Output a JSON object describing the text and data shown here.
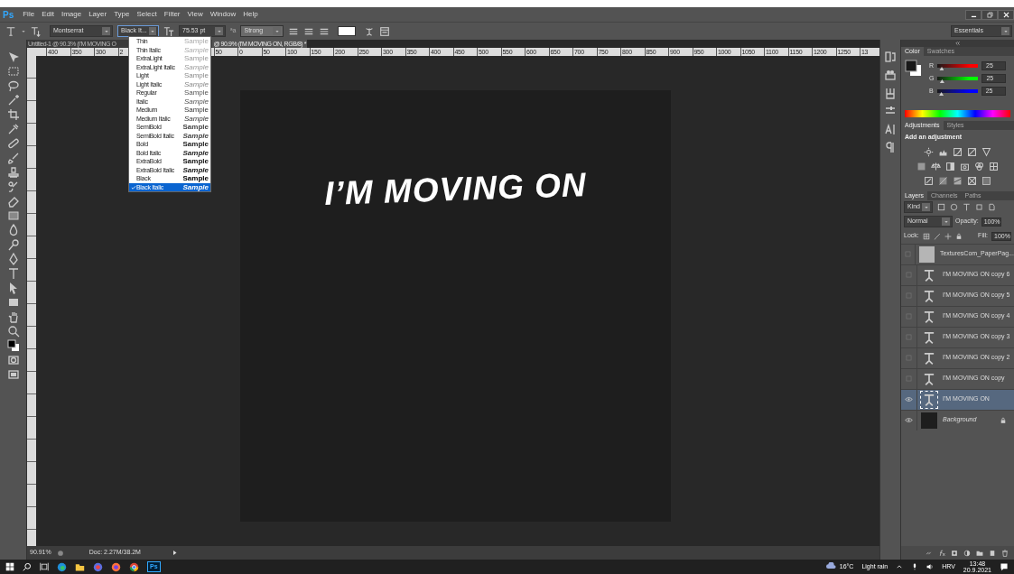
{
  "app": {
    "logo": "Ps"
  },
  "menu": [
    "File",
    "Edit",
    "Image",
    "Layer",
    "Type",
    "Select",
    "Filter",
    "View",
    "Window",
    "Help"
  ],
  "options_bar": {
    "font_family": "Montserrat",
    "font_style": "Black It...",
    "font_size": "75.53 pt",
    "antialias_label": "ªa",
    "antialias": "Strong",
    "workspace": "Essentials"
  },
  "font_style_menu": [
    {
      "name": "Thin",
      "sample": "Sample",
      "kind": "thin",
      "italic": false,
      "selected": false
    },
    {
      "name": "Thin Italic",
      "sample": "Sample",
      "kind": "thin",
      "italic": true,
      "selected": false
    },
    {
      "name": "ExtraLight",
      "sample": "Sample",
      "kind": "extralight",
      "italic": false,
      "selected": false
    },
    {
      "name": "ExtraLight Italic",
      "sample": "Sample",
      "kind": "extralight",
      "italic": true,
      "selected": false
    },
    {
      "name": "Light",
      "sample": "Sample",
      "kind": "light",
      "italic": false,
      "selected": false
    },
    {
      "name": "Light Italic",
      "sample": "Sample",
      "kind": "light",
      "italic": true,
      "selected": false
    },
    {
      "name": "Regular",
      "sample": "Sample",
      "kind": "regular",
      "italic": false,
      "selected": false
    },
    {
      "name": "Italic",
      "sample": "Sample",
      "kind": "regular",
      "italic": true,
      "selected": false
    },
    {
      "name": "Medium",
      "sample": "Sample",
      "kind": "medium",
      "italic": false,
      "selected": false
    },
    {
      "name": "Medium Italic",
      "sample": "Sample",
      "kind": "medium",
      "italic": true,
      "selected": false
    },
    {
      "name": "SemiBold",
      "sample": "Sample",
      "kind": "semibold",
      "italic": false,
      "selected": false
    },
    {
      "name": "SemiBold Italic",
      "sample": "Sample",
      "kind": "semibold",
      "italic": true,
      "selected": false
    },
    {
      "name": "Bold",
      "sample": "Sample",
      "kind": "bold",
      "italic": false,
      "selected": false
    },
    {
      "name": "Bold Italic",
      "sample": "Sample",
      "kind": "bold",
      "italic": true,
      "selected": false
    },
    {
      "name": "ExtraBold",
      "sample": "Sample",
      "kind": "extrabold",
      "italic": false,
      "selected": false
    },
    {
      "name": "ExtraBold Italic",
      "sample": "Sample",
      "kind": "extrabold",
      "italic": true,
      "selected": false
    },
    {
      "name": "Black",
      "sample": "Sample",
      "kind": "black",
      "italic": false,
      "selected": false
    },
    {
      "name": "Black Italic",
      "sample": "Sample",
      "kind": "black",
      "italic": true,
      "selected": true
    }
  ],
  "document_tabs": [
    {
      "label": "Untitled-1 @ 90.3% (I'M MOVING O",
      "selected": false
    },
    {
      "label": "@ 90.9% (I'M MOVING ON, RGB/8) *",
      "selected": true
    }
  ],
  "ruler": {
    "labels_before": [
      "400",
      "350",
      "300",
      "2"
    ],
    "labels_after": [
      "50",
      "0",
      "50",
      "100",
      "150",
      "200",
      "250",
      "300",
      "350",
      "400",
      "450",
      "500",
      "550",
      "600",
      "650",
      "700",
      "750",
      "800",
      "850",
      "900",
      "950",
      "1000",
      "1050",
      "1100",
      "1150",
      "1200",
      "1250",
      "13"
    ]
  },
  "canvas": {
    "text": "I’M MOVING ON"
  },
  "status_bar": {
    "zoom": "90.91%",
    "doc_size": "Doc: 2.27M/38.2M"
  },
  "color_panel": {
    "tabs": [
      {
        "label": "Color",
        "selected": true
      },
      {
        "label": "Swatches",
        "selected": false
      }
    ],
    "channels": [
      {
        "label": "R",
        "value": "25",
        "color": "#ff0000",
        "level": 0.098
      },
      {
        "label": "G",
        "value": "25",
        "color": "#00ff00",
        "level": 0.098
      },
      {
        "label": "B",
        "value": "25",
        "color": "#0000ff",
        "level": 0.098
      }
    ]
  },
  "adjustments_panel": {
    "tabs": [
      {
        "label": "Adjustments",
        "selected": true
      },
      {
        "label": "Styles",
        "selected": false
      }
    ],
    "heading": "Add an adjustment"
  },
  "layers_panel": {
    "tabs": [
      {
        "label": "Layers",
        "selected": true
      },
      {
        "label": "Channels",
        "selected": false
      },
      {
        "label": "Paths",
        "selected": false
      }
    ],
    "filter": "Kind",
    "blend_mode": "Normal",
    "opacity_label": "Opacity:",
    "opacity": "100%",
    "lock_label": "Lock:",
    "fill_label": "Fill:",
    "fill": "100%",
    "layers": [
      {
        "name": "TexturesCom_PaperPag...",
        "kind": "image",
        "visible": false,
        "selected": false
      },
      {
        "name": "I'M MOVING ON copy 6",
        "kind": "text",
        "visible": false,
        "selected": false
      },
      {
        "name": "I'M MOVING ON copy 5",
        "kind": "text",
        "visible": false,
        "selected": false
      },
      {
        "name": "I'M MOVING ON copy 4",
        "kind": "text",
        "visible": false,
        "selected": false
      },
      {
        "name": "I'M MOVING ON copy 3",
        "kind": "text",
        "visible": false,
        "selected": false
      },
      {
        "name": "I'M MOVING ON copy 2",
        "kind": "text",
        "visible": false,
        "selected": false
      },
      {
        "name": "I'M MOVING ON copy",
        "kind": "text",
        "visible": false,
        "selected": false
      },
      {
        "name": "I'M MOVING ON",
        "kind": "text",
        "visible": true,
        "selected": true
      },
      {
        "name": "Background",
        "kind": "background",
        "visible": true,
        "selected": false
      }
    ]
  },
  "taskbar": {
    "app_label": "Ps",
    "temperature": "16°C",
    "weather": "Light rain",
    "language": "HRV",
    "time": "13:48",
    "date": "20.9.2021"
  }
}
